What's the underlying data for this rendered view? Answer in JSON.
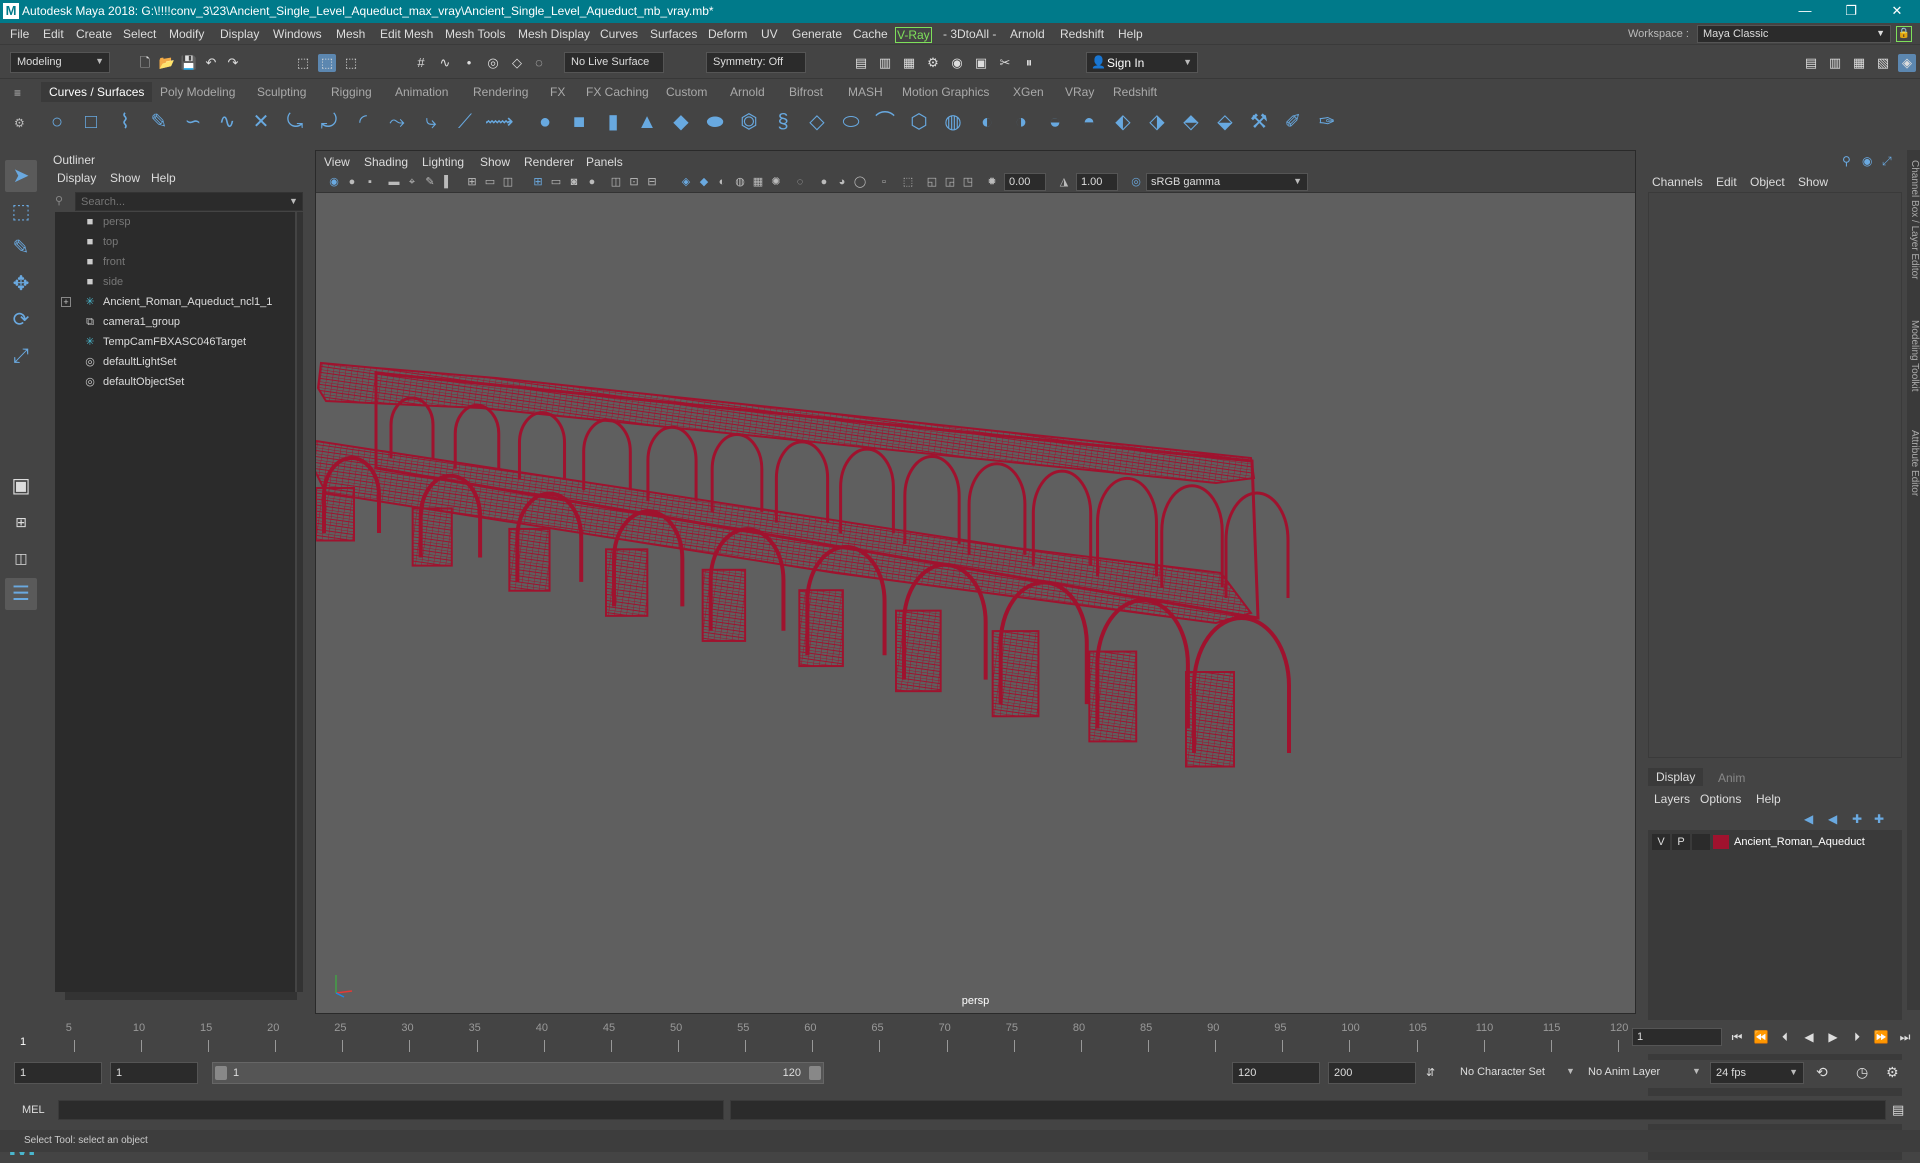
{
  "window": {
    "title": "Autodesk Maya 2018: G:\\!!!!conv_3\\23\\Ancient_Single_Level_Aqueduct_max_vray\\Ancient_Single_Level_Aqueduct_mb_vray.mb*",
    "app_icon": "M",
    "minimize": "—",
    "restore": "❐",
    "close": "✕"
  },
  "menubar": {
    "items": [
      "File",
      "Edit",
      "Create",
      "Select",
      "Modify",
      "Display",
      "Windows",
      "Mesh",
      "Edit Mesh",
      "Mesh Tools",
      "Mesh Display",
      "Curves",
      "Surfaces",
      "Deform",
      "UV",
      "Generate",
      "Cache",
      "V-Ray",
      "- 3DtoAll -",
      "Arnold",
      "Redshift",
      "Help"
    ],
    "workspace_label": "Workspace :",
    "workspace_value": "Maya Classic"
  },
  "statusline": {
    "mode": "Modeling",
    "live_surface": "No Live Surface",
    "symmetry": "Symmetry: Off",
    "sign_in": "Sign In"
  },
  "shelf": {
    "tabs": [
      "Curves / Surfaces",
      "Poly Modeling",
      "Sculpting",
      "Rigging",
      "Animation",
      "Rendering",
      "FX",
      "FX Caching",
      "Custom",
      "Arnold",
      "Bifrost",
      "MASH",
      "Motion Graphics",
      "XGen",
      "VRay",
      "Redshift"
    ],
    "active_tab": "Curves / Surfaces"
  },
  "outliner": {
    "title": "Outliner",
    "menus": [
      "Display",
      "Show",
      "Help"
    ],
    "search_placeholder": "Search...",
    "items": [
      {
        "label": "persp",
        "icon": "camera-icon",
        "dim": true
      },
      {
        "label": "top",
        "icon": "camera-icon",
        "dim": true
      },
      {
        "label": "front",
        "icon": "camera-icon",
        "dim": true
      },
      {
        "label": "side",
        "icon": "camera-icon",
        "dim": true
      },
      {
        "label": "Ancient_Roman_Aqueduct_ncl1_1",
        "icon": "locator-icon",
        "dim": false,
        "expandable": true
      },
      {
        "label": "camera1_group",
        "icon": "group-icon",
        "dim": false
      },
      {
        "label": "TempCamFBXASC046Target",
        "icon": "locator-icon",
        "dim": false
      },
      {
        "label": "defaultLightSet",
        "icon": "set-icon",
        "dim": false
      },
      {
        "label": "defaultObjectSet",
        "icon": "set-icon",
        "dim": false
      }
    ]
  },
  "viewport": {
    "menus": [
      "View",
      "Shading",
      "Lighting",
      "Show",
      "Renderer",
      "Panels"
    ],
    "exposure": "0.00",
    "gamma": "1.00",
    "color_space": "sRGB gamma",
    "camera_label": "persp",
    "wire_color": "#a0122e"
  },
  "channelbox": {
    "menus": [
      "Channels",
      "Edit",
      "Object",
      "Show"
    ],
    "layer_tabs": [
      "Display",
      "Anim"
    ],
    "layer_menus": [
      "Layers",
      "Options",
      "Help"
    ],
    "layer": {
      "v": "V",
      "p": "P",
      "name": "Ancient_Roman_Aqueduct",
      "color": "#a0122e"
    },
    "side_tabs": [
      "Channel Box / Layer Editor",
      "Modeling Toolkit",
      "Attribute Editor"
    ]
  },
  "timeslider": {
    "ticks": [
      5,
      10,
      15,
      20,
      25,
      30,
      35,
      40,
      45,
      50,
      55,
      60,
      65,
      70,
      75,
      80,
      85,
      90,
      95,
      100,
      105,
      110,
      115,
      120
    ],
    "first_frame_label": "1",
    "current_frame": "1"
  },
  "rangeslider": {
    "start_frame": "1",
    "playback_start": "1",
    "range_start": "1",
    "range_end": "120",
    "playback_end": "120",
    "end_frame": "200",
    "character_set": "No Character Set",
    "anim_layer": "No Anim Layer",
    "fps": "24 fps"
  },
  "cmdline": {
    "label": "MEL"
  },
  "helpline": {
    "text": "Select Tool: select an object"
  }
}
